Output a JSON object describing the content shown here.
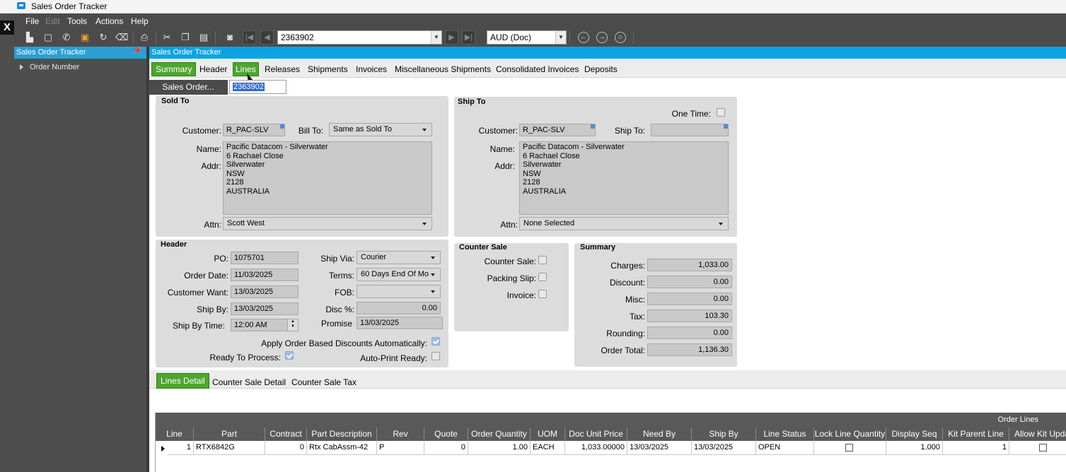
{
  "window": {
    "title": "Sales Order Tracker"
  },
  "menu": {
    "file": "File",
    "edit": "Edit",
    "tools": "Tools",
    "actions": "Actions",
    "help": "Help"
  },
  "toolbar": {
    "order_number": "2363902",
    "currency": "AUD (Doc)",
    "icons": [
      "new-icon",
      "note-icon",
      "phone-icon",
      "attachment-icon",
      "refresh-icon",
      "clear-icon",
      "print-icon",
      "cut-icon",
      "copy-icon",
      "paste-icon",
      "binoculars-icon",
      "first-record-icon",
      "previous-record-icon",
      "next-record-icon",
      "last-record-icon",
      "back-icon",
      "forward-icon",
      "home-icon"
    ]
  },
  "nav_panel": {
    "title": "Sales Order Tracker",
    "tree_item": "Order Number"
  },
  "main": {
    "title": "Sales Order Tracker",
    "tabs": [
      "Summary",
      "Header",
      "Lines",
      "Releases",
      "Shipments",
      "Invoices",
      "Miscellaneous Shipments",
      "Consolidated Invoices",
      "Deposits"
    ],
    "sales_order_button": "Sales Order...",
    "sales_order_value": "2363902"
  },
  "sold_to": {
    "title": "Sold To",
    "customer_label": "Customer:",
    "customer": "R_PAC-SLV",
    "bill_to_label": "Bill To:",
    "bill_to": "Same as Sold To",
    "name_label": "Name:",
    "addr_label": "Addr:",
    "address_lines": [
      "Pacific Datacom - Silverwater",
      "6 Rachael Close",
      "Silverwater",
      "NSW",
      "2128",
      "AUSTRALIA"
    ],
    "attn_label": "Attn:",
    "attn": "Scott West"
  },
  "ship_to": {
    "title": "Ship To",
    "one_time_label": "One Time:",
    "customer_label": "Customer:",
    "customer": "R_PAC-SLV",
    "ship_to_label": "Ship To:",
    "ship_to": "",
    "name_label": "Name:",
    "addr_label": "Addr:",
    "address_lines": [
      "Pacific Datacom - Silverwater",
      "6 Rachael Close",
      "Silverwater",
      "NSW",
      "2128",
      "AUSTRALIA"
    ],
    "attn_label": "Attn:",
    "attn": "None Selected"
  },
  "header": {
    "title": "Header",
    "po_label": "PO:",
    "po": "1075701",
    "order_date_label": "Order Date:",
    "order_date": "11/03/2025",
    "customer_want_label": "Customer Want:",
    "customer_want": "13/03/2025",
    "ship_by_label": "Ship By:",
    "ship_by": "13/03/2025",
    "ship_by_time_label": "Ship By Time:",
    "ship_by_time": "12:00 AM",
    "ship_via_label": "Ship Via:",
    "ship_via": "Courier",
    "terms_label": "Terms:",
    "terms": "60 Days End Of Mo",
    "fob_label": "FOB:",
    "fob": "",
    "disc_label": "Disc %:",
    "disc": "0.00",
    "promise_label": "Promise",
    "promise": "13/03/2025",
    "apply_discounts_label": "Apply Order Based Discounts Automatically:",
    "ready_label": "Ready To Process:",
    "auto_print_label": "Auto-Print Ready:"
  },
  "counter_sale": {
    "title": "Counter Sale",
    "counter_sale_label": "Counter Sale:",
    "packing_slip_label": "Packing Slip:",
    "invoice_label": "Invoice:"
  },
  "summary": {
    "title": "Summary",
    "charges_label": "Charges:",
    "charges": "1,033.00",
    "discount_label": "Discount:",
    "discount": "0.00",
    "misc_label": "Misc:",
    "misc": "0.00",
    "tax_label": "Tax:",
    "tax": "103.30",
    "rounding_label": "Rounding:",
    "rounding": "0.00",
    "order_total_label": "Order Total:",
    "order_total": "1,136.30"
  },
  "sub_tabs": [
    "Lines Detail",
    "Counter Sale Detail",
    "Counter Sale Tax"
  ],
  "grid": {
    "caption": "Order Lines",
    "headers": [
      "Line",
      "Part",
      "Contract",
      "Part Description",
      "Rev",
      "Quote",
      "Order Quantity",
      "UOM",
      "Doc Unit Price",
      "Need By",
      "Ship By",
      "Line Status",
      "Lock Line Quantity",
      "Display Seq",
      "Kit Parent Line",
      "Allow Kit Upda"
    ],
    "row": [
      "1",
      "RTX6842G",
      "0",
      "Rtx CabAssm-42",
      "P",
      "0",
      "1.00",
      "EACH",
      "1,033.00000",
      "13/03/2025",
      "13/03/2025",
      "OPEN",
      "",
      "1.000",
      "1",
      ""
    ]
  }
}
